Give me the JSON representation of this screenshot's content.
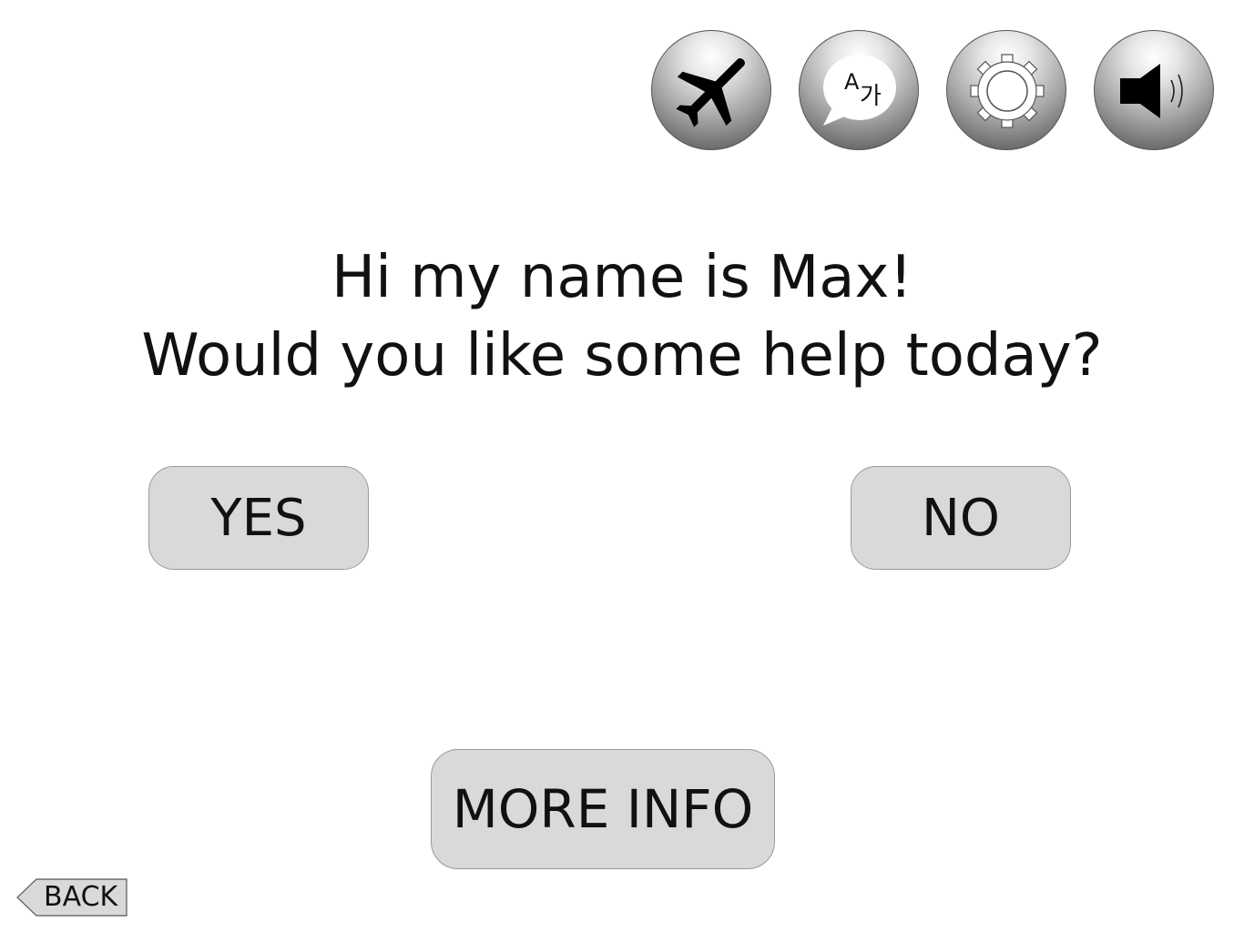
{
  "toolbar": {
    "buttons": [
      {
        "name": "airplane",
        "icon": "airplane-icon"
      },
      {
        "name": "language",
        "icon": "language-bubble-icon",
        "glyph_latin": "A",
        "glyph_korean": "가"
      },
      {
        "name": "settings",
        "icon": "gear-icon"
      },
      {
        "name": "sound",
        "icon": "speaker-icon"
      }
    ]
  },
  "greeting": {
    "line1": "Hi my name is Max!",
    "line2": "Would you like some help today?"
  },
  "actions": {
    "yes_label": "YES",
    "no_label": "NO",
    "more_info_label": "MORE INFO"
  },
  "navigation": {
    "back_label": "BACK"
  },
  "colors": {
    "button_fill": "#d9d9d9",
    "button_border": "#9a9a9a",
    "text": "#111111"
  }
}
